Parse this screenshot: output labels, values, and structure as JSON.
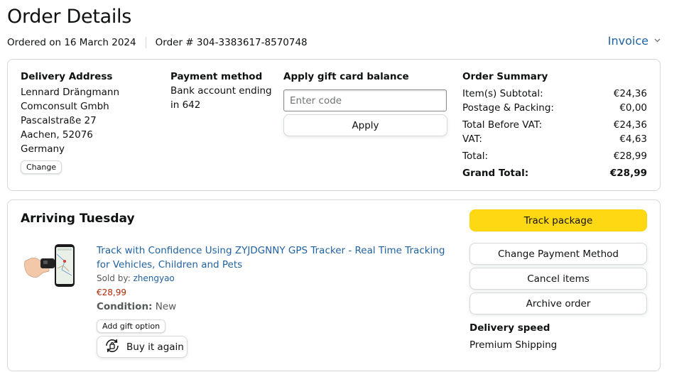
{
  "header": {
    "title": "Order Details",
    "ordered_on": "Ordered on 16 March 2024",
    "order_number": "Order # 304-3383617-8570748",
    "invoice_label": "Invoice"
  },
  "delivery": {
    "heading": "Delivery Address",
    "lines": [
      "Lennard Drängmann",
      "Comconsult Gmbh",
      "Pascalstraße 27",
      "Aachen, 52076",
      "Germany"
    ],
    "change_label": "Change"
  },
  "payment": {
    "heading": "Payment method",
    "line1": "Bank account ending",
    "line2": "in 642"
  },
  "gift_card": {
    "heading": "Apply gift card balance",
    "placeholder": "Enter code",
    "apply_label": "Apply"
  },
  "summary": {
    "heading": "Order Summary",
    "rows": [
      {
        "label": "Item(s) Subtotal:",
        "value": "€24,36"
      },
      {
        "label": "Postage & Packing:",
        "value": "€0,00"
      },
      {
        "label": "Total Before VAT:",
        "value": "€24,36"
      },
      {
        "label": "VAT:",
        "value": "€4,63"
      },
      {
        "label": "Total:",
        "value": "€28,99"
      },
      {
        "label": "Grand Total:",
        "value": "€28,99"
      }
    ]
  },
  "shipment": {
    "status": "Arriving Tuesday",
    "product_title": "Track with Confidence Using ZYJDGNNY GPS Tracker - Real Time Tracking for Vehicles, Children and Pets",
    "sold_by_label": "Sold by:",
    "seller": "zhengyao",
    "price": "€28,99",
    "condition_label": "Condition:",
    "condition_value": "New",
    "gift_label": "Add gift option",
    "buy_again_label": "Buy it again",
    "buttons": {
      "track": "Track package",
      "change_payment": "Change Payment Method",
      "cancel": "Cancel items",
      "archive": "Archive order"
    },
    "delivery_speed_label": "Delivery speed",
    "delivery_speed_value": "Premium Shipping"
  },
  "colors": {
    "link": "#2162a1",
    "price": "#b12704",
    "track_button": "#ffd814"
  },
  "icons": [
    "chevron-down-icon",
    "buy-again-icon",
    "product-image"
  ]
}
